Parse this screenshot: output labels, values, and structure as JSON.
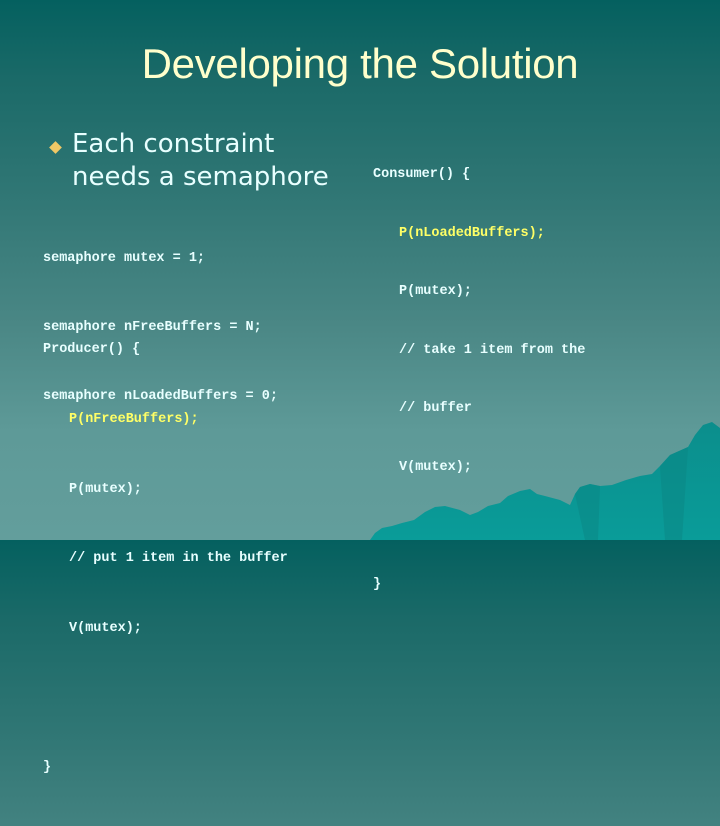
{
  "slide": {
    "title": "Developing the Solution",
    "bullet": {
      "icon": "diamond-bullet-icon",
      "line1": "Each constraint",
      "line2": "needs a semaphore"
    },
    "declarations": [
      "semaphore mutex = 1;",
      "semaphore nFreeBuffers = N;",
      "semaphore nLoadedBuffers = 0;"
    ],
    "producer": {
      "header": "Producer() {",
      "lines": [
        "P(nFreeBuffers);",
        "P(mutex);",
        "// put 1 item in the buffer",
        "V(mutex);"
      ],
      "footer": "}"
    },
    "consumer": {
      "header": "Consumer() {",
      "lines": [
        "P(nLoadedBuffers);",
        "P(mutex);",
        "// take 1 item from the",
        "// buffer",
        "V(mutex);"
      ],
      "footer": "}"
    },
    "colors": {
      "title": "#ffffcc",
      "text": "#e8ffff",
      "highlight": "#ffff66",
      "bullet": "#f0c866",
      "background_top": "#04605f",
      "background_bottom": "#639e9c",
      "mountain": "#0a9593"
    }
  }
}
